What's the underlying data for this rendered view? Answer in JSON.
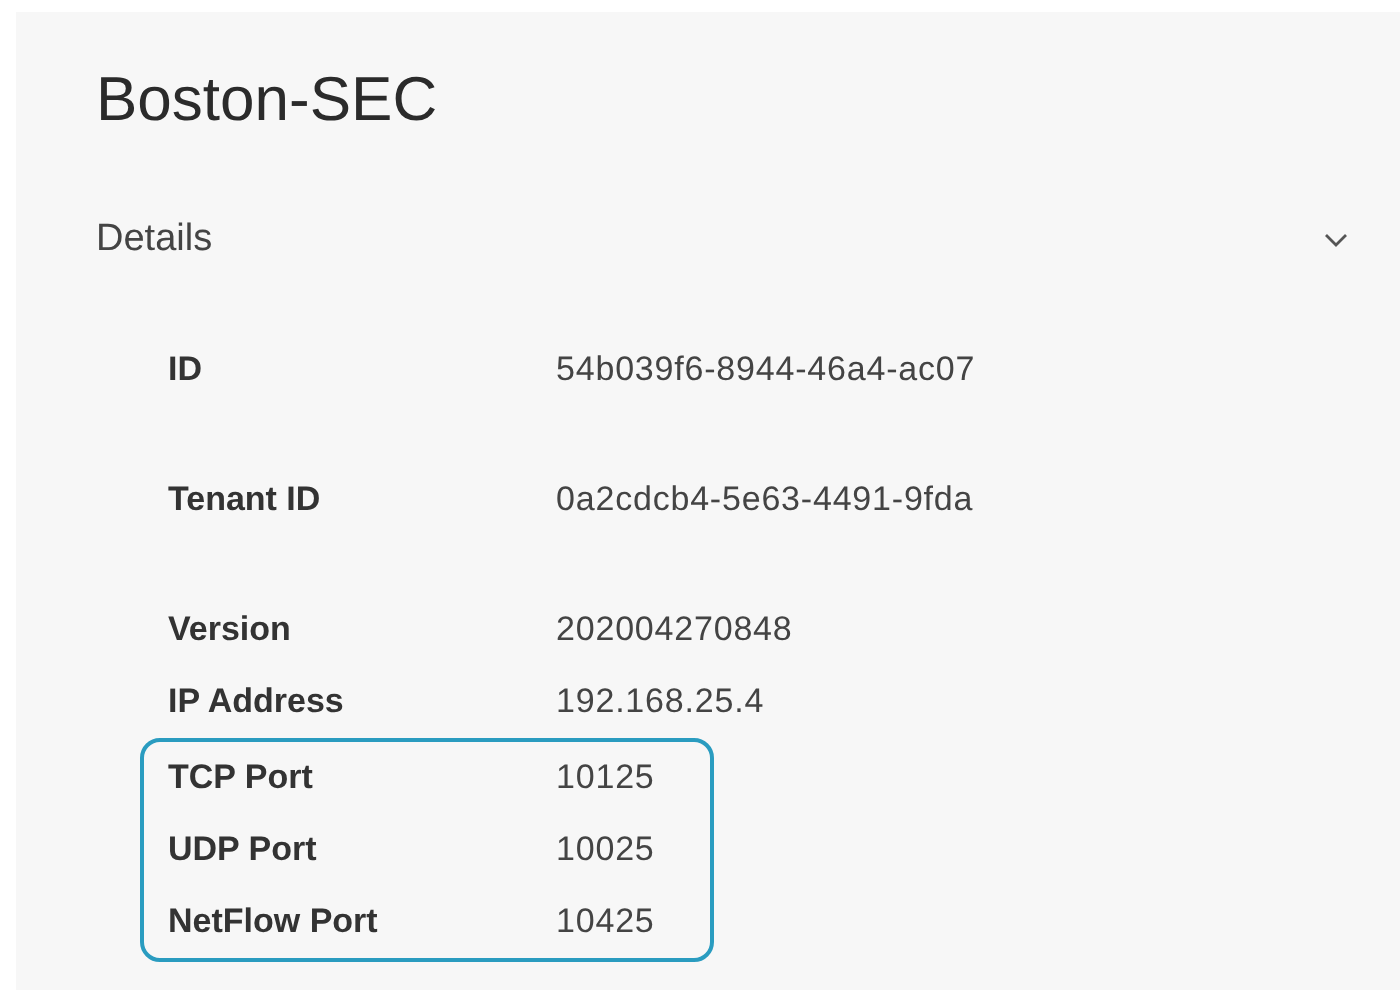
{
  "title": "Boston-SEC",
  "section": {
    "label": "Details",
    "expanded": true
  },
  "rows": [
    {
      "label": "ID",
      "value": "54b039f6-8944-46a4-ac07",
      "highlighted": false
    },
    {
      "label": "Tenant ID",
      "value": "0a2cdcb4-5e63-4491-9fda",
      "highlighted": false
    },
    {
      "label": "Version",
      "value": "202004270848",
      "highlighted": false
    },
    {
      "label": "IP Address",
      "value": "192.168.25.4",
      "highlighted": false
    },
    {
      "label": "TCP Port",
      "value": "10125",
      "highlighted": true
    },
    {
      "label": "UDP Port",
      "value": "10025",
      "highlighted": true
    },
    {
      "label": "NetFlow Port",
      "value": "10425",
      "highlighted": true
    }
  ]
}
